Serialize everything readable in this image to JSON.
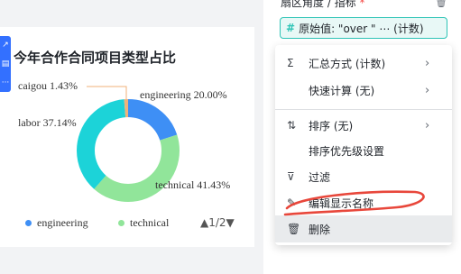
{
  "side_tools": [
    "↗",
    "▤",
    "···"
  ],
  "card": {
    "title": "今年合作合同项目类型占比"
  },
  "chart_data": {
    "type": "pie",
    "categories": [
      "engineering",
      "technical",
      "labor",
      "caigou"
    ],
    "values": [
      20.0,
      41.43,
      37.14,
      1.43
    ],
    "colors": [
      "#3e8ff5",
      "#91e59a",
      "#1cd3d8",
      "#f0b27a"
    ],
    "data_labels": [
      "engineering 20.00%",
      "technical 41.43%",
      "labor 37.14%",
      "caigou 1.43%"
    ],
    "legend": [
      "engineering",
      "technical"
    ],
    "legend_page": "1/2"
  },
  "panel": {
    "field_label": "扇区角度 / 指标",
    "required_mark": "*",
    "chip_text": "原始值: \"over \" ⋯  (计数)"
  },
  "menu": {
    "items": [
      {
        "icon": "Σ",
        "label": "汇总方式 (计数)",
        "chevron": "›"
      },
      {
        "icon": "",
        "label": "快速计算 (无)",
        "chevron": "›"
      },
      {
        "icon": "⇅",
        "label": "排序 (无)",
        "chevron": "›"
      },
      {
        "icon": "",
        "label": "排序优先级设置",
        "chevron": ""
      },
      {
        "icon": "⊽",
        "label": "过滤",
        "chevron": ""
      },
      {
        "icon": "✎",
        "label": "编辑显示名称",
        "chevron": ""
      },
      {
        "icon": "🗑",
        "label": "删除",
        "chevron": ""
      }
    ]
  }
}
